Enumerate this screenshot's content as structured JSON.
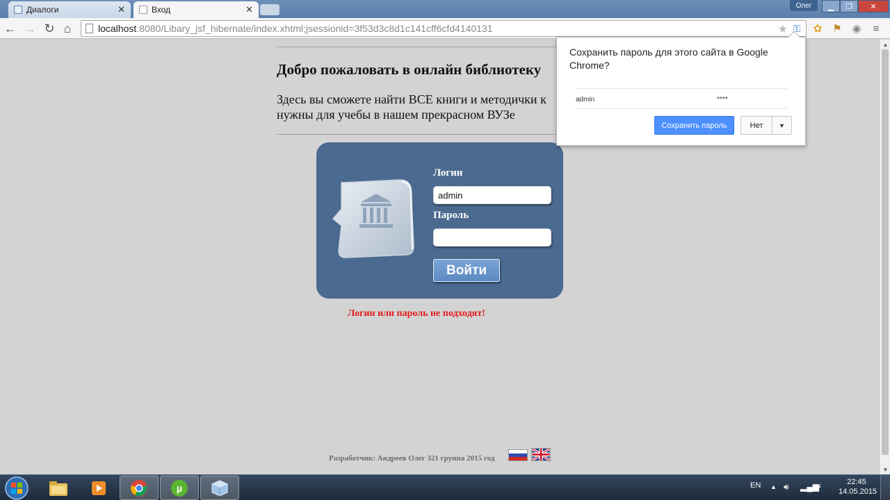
{
  "browser": {
    "tabs": [
      {
        "title": "Диалоги",
        "active": false
      },
      {
        "title": "Вход",
        "active": true
      }
    ],
    "user_badge": "Олег",
    "url": {
      "host": "localhost",
      "path": ":8080/Libary_jsf_hibernate/index.xhtml;jsessionid=3f53d3c8d1c141cff6cfd4140131"
    }
  },
  "page": {
    "welcome": "Добро пожаловать в онлайн библиотеку",
    "intro": "Здесь вы сможете найти ВСЕ книги и методички к нужны для учебы в нашем прекрасном ВУЗе",
    "login": {
      "login_label": "Логин",
      "login_value": "admin",
      "password_label": "Пароль",
      "password_value": "",
      "submit_label": "Войти"
    },
    "error": "Логин или пароль не подходят!",
    "footer": "Разработчик: Андреев Олег 321 группа 2015 год"
  },
  "save_password_bubble": {
    "title": "Сохранить пароль для этого сайта в Google Chrome?",
    "username": "admin",
    "password_mask": "****",
    "save_label": "Сохранить пароль",
    "no_label": "Нет"
  },
  "taskbar": {
    "lang": "EN",
    "time": "22:45",
    "date": "14.05.2015"
  },
  "colors": {
    "page_bg": "#d3d3d3",
    "panel_bg": "#4b6a8f",
    "error": "#e31b1b",
    "save_btn": "#4d90fe"
  }
}
